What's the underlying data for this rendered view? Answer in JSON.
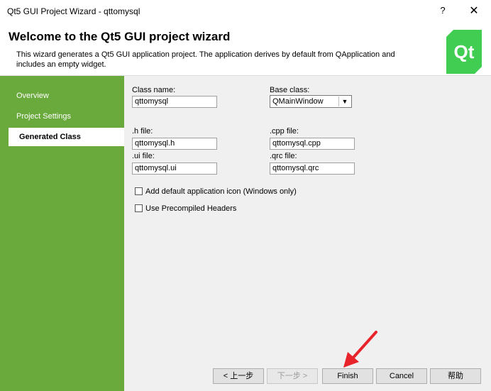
{
  "window": {
    "title": "Qt5 GUI Project Wizard - qttomysql",
    "help_glyph": "?",
    "close_glyph": "✕"
  },
  "header": {
    "title": "Welcome to the Qt5 GUI project wizard",
    "description": "This wizard generates a Qt5 GUI application project. The application derives by default from QApplication and includes an empty widget.",
    "logo_text": "Qt"
  },
  "sidebar": {
    "items": [
      {
        "label": "Overview"
      },
      {
        "label": "Project Settings"
      },
      {
        "label": "Generated Class"
      }
    ]
  },
  "form": {
    "class_name": {
      "label": "Class name:",
      "value": "qttomysql"
    },
    "base_class": {
      "label": "Base class:",
      "value": "QMainWindow"
    },
    "h_file": {
      "label": ".h file:",
      "value": "qttomysql.h"
    },
    "cpp_file": {
      "label": ".cpp file:",
      "value": "qttomysql.cpp"
    },
    "ui_file": {
      "label": ".ui file:",
      "value": "qttomysql.ui"
    },
    "qrc_file": {
      "label": ".qrc file:",
      "value": "qttomysql.qrc"
    },
    "check_icon": {
      "label": "Add default application icon (Windows only)",
      "checked": false
    },
    "check_pch": {
      "label": "Use Precompiled Headers",
      "checked": false
    }
  },
  "buttons": {
    "back": "< 上一步",
    "next": "下一步 >",
    "finish": "Finish",
    "cancel": "Cancel",
    "help": "帮助"
  },
  "colors": {
    "sidebar": "#6aa93b",
    "logo": "#41cd52",
    "annotation_arrow": "#e8232a"
  }
}
